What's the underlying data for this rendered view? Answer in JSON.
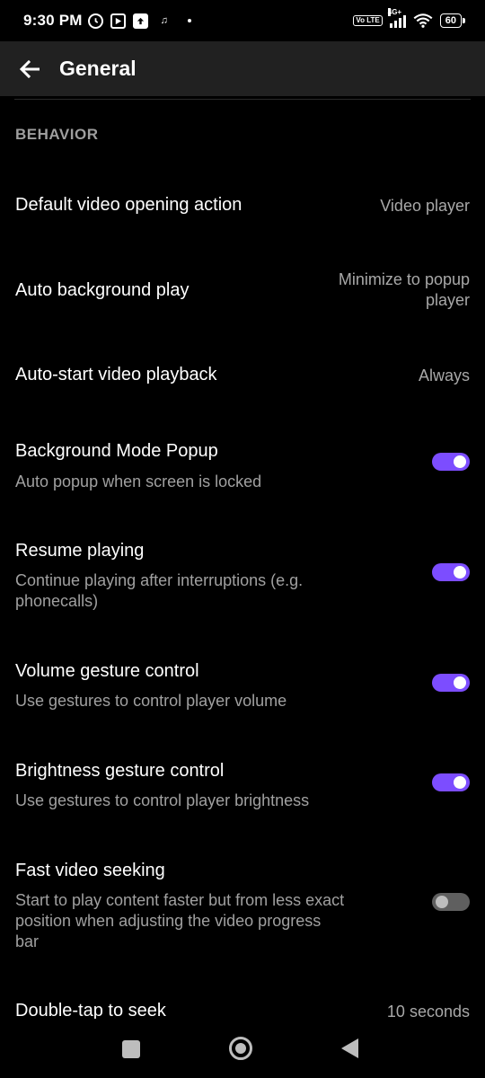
{
  "status_bar": {
    "time": "9:30 PM",
    "network": "4G+",
    "volte": "Vo LTE",
    "battery": "60",
    "icons": [
      "alarm-icon",
      "play-icon",
      "upload-icon",
      "music-icon",
      "dot-icon",
      "volte-icon",
      "signal-icon",
      "wifi-icon",
      "battery-icon"
    ]
  },
  "app_bar": {
    "title": "General",
    "back_icon": "arrow-back-icon"
  },
  "section": {
    "header": "BEHAVIOR"
  },
  "preferences": [
    {
      "title": "Default video opening action",
      "value": "Video player"
    },
    {
      "title": "Auto background play",
      "value": "Minimize to popup player"
    },
    {
      "title": "Auto-start video playback",
      "value": "Always"
    },
    {
      "title": "Background Mode Popup",
      "summary": "Auto popup when screen is locked",
      "enabled": true
    },
    {
      "title": "Resume playing",
      "summary": "Continue playing after interruptions (e.g. phonecalls)",
      "enabled": true
    },
    {
      "title": "Volume gesture control",
      "summary": "Use gestures to control player volume",
      "enabled": true
    },
    {
      "title": "Brightness gesture control",
      "summary": "Use gestures to control player brightness",
      "enabled": true
    },
    {
      "title": "Fast video seeking",
      "summary": "Start to play content faster but from less exact position when adjusting the video progress bar",
      "enabled": false
    },
    {
      "title": "Double-tap to seek",
      "value": "10 seconds"
    }
  ],
  "colors": {
    "accent": "#7c4dff",
    "background": "#000000",
    "app_bar": "#212121",
    "secondary_text": "#a0a0a0"
  },
  "nav_bar": {
    "icons": [
      "recents-square-icon",
      "home-circle-icon",
      "back-triangle-icon"
    ]
  }
}
